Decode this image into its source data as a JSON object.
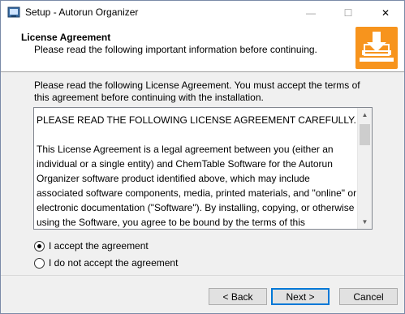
{
  "window": {
    "title": "Setup - Autorun Organizer",
    "minimize_glyph": "—",
    "maximize_glyph": "☐",
    "close_glyph": "✕"
  },
  "header": {
    "title": "License Agreement",
    "subtitle": "Please read the following important information before continuing.",
    "icon": "download-to-laptop-icon",
    "icon_color": "#f7941d"
  },
  "intro_text": "Please read the following License Agreement. You must accept the terms of this agreement before continuing with the installation.",
  "license": {
    "text": "PLEASE READ THE FOLLOWING LICENSE AGREEMENT CAREFULLY.\n\nThis License Agreement is a legal agreement between you (either an individual or a single entity) and ChemTable Software for the Autorun Organizer software product identified above, which may include associated software components, media, printed materials, and \"online\" or electronic documentation (\"Software\"). By installing, copying, or otherwise using the Software, you agree to be bound by the terms of this Agreement. If you do not agree to the terms of this Agreement,"
  },
  "options": {
    "accept_label": "I accept the agreement",
    "decline_label": "I do not accept the agreement",
    "selected": "accept"
  },
  "buttons": {
    "back": "< Back",
    "next": "Next >",
    "cancel": "Cancel"
  },
  "colors": {
    "accent": "#0078d7",
    "header_icon": "#f7941d"
  }
}
